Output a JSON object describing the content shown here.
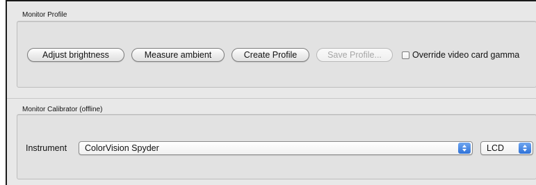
{
  "monitor_profile": {
    "title": "Monitor Profile",
    "buttons": {
      "adjust_brightness": "Adjust brightness",
      "measure_ambient": "Measure ambient",
      "create_profile": "Create Profile",
      "save_profile": "Save Profile..."
    },
    "override_gamma_label": "Override video card gamma",
    "override_gamma_checked": false
  },
  "monitor_calibrator": {
    "title": "Monitor Calibrator (offline)",
    "instrument_label": "Instrument",
    "instrument_value": "ColorVision Spyder",
    "display_type_value": "LCD"
  },
  "icons": {
    "select_arrows": "up-down-chevron-icon"
  },
  "colors": {
    "select_accent": "#2f72d8"
  }
}
